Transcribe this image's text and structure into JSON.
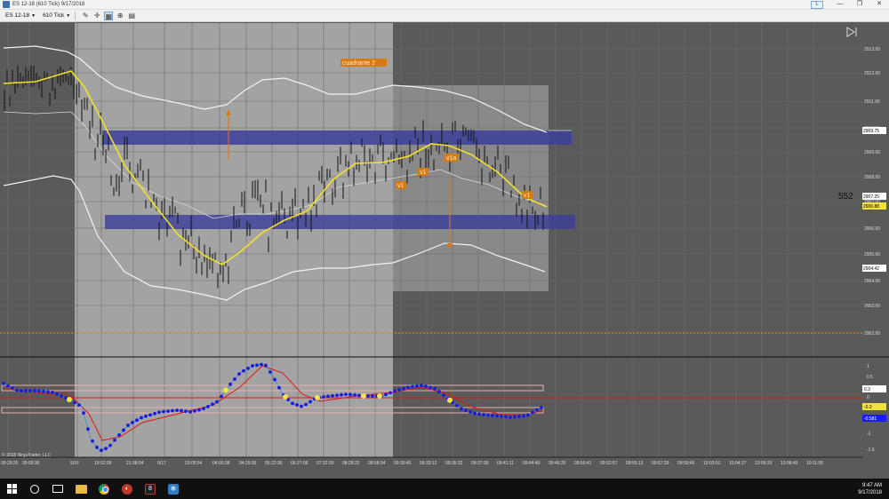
{
  "window": {
    "title": "ES 12-18 (610 Tick)  9/17/2018",
    "layout_button": "L",
    "minimize": "—",
    "maximize": "❐",
    "close": "✕"
  },
  "toolbar": {
    "instrument": "ES 12-18",
    "interval": "610 Tick",
    "icons": [
      "pencil-icon",
      "crosshair-icon",
      "chart-style-icon",
      "zoom-icon",
      "properties-icon"
    ]
  },
  "chart": {
    "bar_count_label": "552",
    "copyright": "© 2018 NinjaTrader, LLC",
    "annotations": [
      "cuadrante 2",
      "v1",
      "v1",
      "v1a",
      "v1"
    ],
    "price_axis": {
      "ticks": [
        "2913.00",
        "2912.00",
        "2911.00",
        "2910.00",
        "2909.00",
        "2908.00",
        "2907.00",
        "2906.00",
        "2905.00",
        "2904.00",
        "2903.00",
        "2902.00"
      ],
      "markers": [
        {
          "label": "2909.75",
          "fill": "#ffffff",
          "text": "#000000"
        },
        {
          "label": "2907.25",
          "fill": "#ffffff",
          "text": "#000000"
        },
        {
          "label": "2906.88",
          "fill": "#f0e040",
          "text": "#000000"
        },
        {
          "label": "2904.42",
          "fill": "#ffffff",
          "text": "#000000"
        }
      ]
    },
    "osc_axis": {
      "ticks": [
        "1",
        "0.5",
        "0",
        "-0.5",
        "-1",
        "-1.5"
      ],
      "markers": [
        {
          "label": "0.3",
          "fill": "#ffffff",
          "text": "#000000"
        },
        {
          "label": "-0.2",
          "fill": "#f0e040",
          "text": "#000000"
        },
        {
          "label": "-0.581",
          "fill": "#1a1aff",
          "text": "#ffffff"
        }
      ]
    },
    "time_axis": [
      "09:29:26",
      "09:00:36",
      "9/16",
      "19:52:09",
      "21:38:04",
      "9/17",
      "03:05:54",
      "04:00:38",
      "04:29:35",
      "05:22:36",
      "06:27:06",
      "07:32:39",
      "08:28:22",
      "08:58:34",
      "09:30:46",
      "09:33:12",
      "09:35:32",
      "09:37:39",
      "09:41:11",
      "09:44:40",
      "09:46:25",
      "09:50:41",
      "09:52:57",
      "09:55:13",
      "09:57:29",
      "09:59:45",
      "10:02:01",
      "10:04:17",
      "10:06:33",
      "10:08:49",
      "10:11:05"
    ],
    "colors": {
      "background": "#5a5a5a",
      "session_shade": "#a3a3a3",
      "zone": "#3b3f9a",
      "envelope": "#f2f2f2",
      "ma": "#f1e12a",
      "osc_dots": "#1a1adf",
      "osc_signal": "#e01818",
      "annotation_box": "#d87a12"
    }
  },
  "taskbar": {
    "time": "9:47 AM",
    "date": "9/17/2018"
  }
}
